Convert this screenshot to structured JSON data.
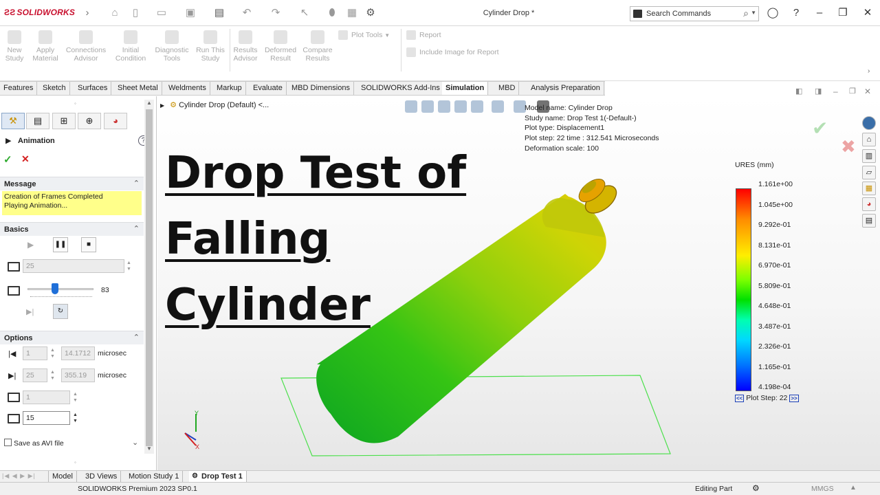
{
  "app": {
    "brand": "SOLIDWORKS",
    "window_title": "Cylinder Drop *"
  },
  "search": {
    "placeholder": "Search Commands"
  },
  "ribbon": {
    "buttons": [
      {
        "line1": "New",
        "line2": "Study"
      },
      {
        "line1": "Apply",
        "line2": "Material"
      },
      {
        "line1": "Connections",
        "line2": "Advisor"
      },
      {
        "line1": "Initial",
        "line2": "Condition"
      },
      {
        "line1": "Diagnostic",
        "line2": "Tools"
      },
      {
        "line1": "Run This",
        "line2": "Study"
      },
      {
        "line1": "Results",
        "line2": "Advisor"
      },
      {
        "line1": "Deformed",
        "line2": "Result"
      },
      {
        "line1": "Compare",
        "line2": "Results"
      }
    ],
    "plot_tools": "Plot Tools",
    "report": "Report",
    "include_image": "Include Image for Report"
  },
  "tabs": [
    "Features",
    "Sketch",
    "Surfaces",
    "Sheet Metal",
    "Weldments",
    "Markup",
    "Evaluate",
    "MBD Dimensions",
    "SOLIDWORKS Add-Ins",
    "Simulation",
    "MBD",
    "Analysis Preparation"
  ],
  "active_tab": "Simulation",
  "property_manager": {
    "title": "Animation",
    "message_header": "Message",
    "message_line1": "Creation of Frames Completed",
    "message_line2": "Playing Animation...",
    "basics_header": "Basics",
    "frames": "25",
    "speed_value": "83",
    "speed_fraction": 0.42,
    "options_header": "Options",
    "start_step": "1",
    "start_time": "14.1712",
    "end_step": "25",
    "end_time": "355.19",
    "unit": "microsec",
    "step_increment": "1",
    "fps": "15",
    "save_avi": "Save as AVI file"
  },
  "viewport": {
    "breadcrumb": "Cylinder Drop (Default) <...",
    "plot_info": {
      "model_name": "Model name: Cylinder Drop",
      "study_name": "Study name: Drop Test 1(-Default-)",
      "plot_type": "Plot type: Displacement1",
      "plot_step": "Plot step: 22   time : 312.541 Microseconds",
      "deformation": "Deformation scale: 100"
    },
    "headline": [
      "Drop Test of",
      "Falling",
      "Cylinder"
    ],
    "legend": {
      "title": "URES (mm)",
      "ticks": [
        "1.161e+00",
        "1.045e+00",
        "9.292e-01",
        "8.131e-01",
        "6.970e-01",
        "5.809e-01",
        "4.648e-01",
        "3.487e-01",
        "2.326e-01",
        "1.165e-01",
        "4.198e-04"
      ],
      "plot_step": "Plot Step: 22"
    },
    "colors": {
      "confirm": "#2eaa2e",
      "cancel": "#d42020",
      "floor": "#3ee83e"
    }
  },
  "bottom_tabs": [
    "Model",
    "3D Views",
    "Motion Study 1",
    "Drop Test 1"
  ],
  "active_bottom_tab": "Drop Test 1",
  "status": {
    "product": "SOLIDWORKS Premium 2023 SP0.1",
    "mode": "Editing Part",
    "units": "MMGS"
  }
}
